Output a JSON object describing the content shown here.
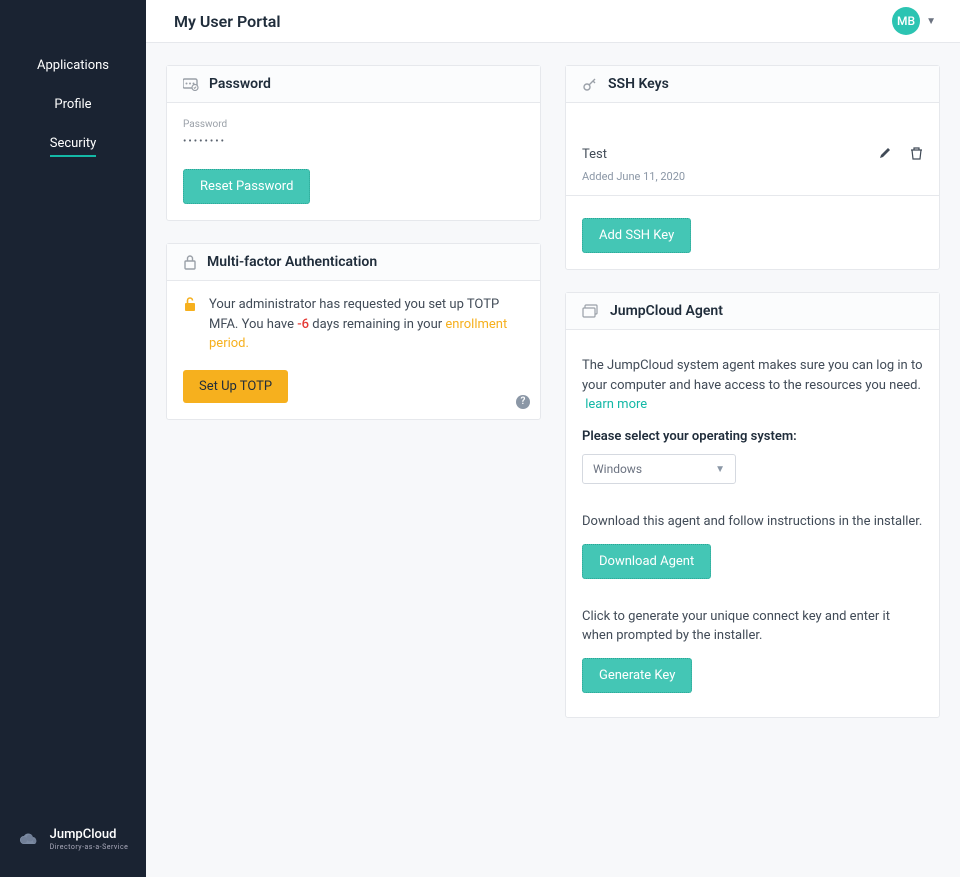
{
  "header": {
    "title": "My User Portal",
    "avatar_initials": "MB"
  },
  "sidebar": {
    "items": [
      {
        "label": "Applications"
      },
      {
        "label": "Profile"
      },
      {
        "label": "Security"
      }
    ],
    "brand": {
      "name": "JumpCloud",
      "tagline": "Directory-as-a-Service"
    }
  },
  "password": {
    "card_title": "Password",
    "field_label": "Password",
    "masked_value": "••••••••",
    "reset_btn": "Reset Password"
  },
  "mfa": {
    "card_title": "Multi-factor Authentication",
    "alert_prefix": "Your administrator has requested you set up TOTP MFA. You have ",
    "days_remaining": "-6",
    "alert_mid": " days remaining in your ",
    "link_text": "enrollment period.",
    "setup_btn": "Set Up TOTP"
  },
  "ssh": {
    "card_title": "SSH Keys",
    "keys": [
      {
        "name": "Test",
        "added": "Added June 11, 2020"
      }
    ],
    "add_btn": "Add SSH Key"
  },
  "agent": {
    "card_title": "JumpCloud Agent",
    "description": "The JumpCloud system agent makes sure you can log in to your computer and have access to the resources you need.",
    "learn_more": "learn more",
    "os_label": "Please select your operating system:",
    "os_selected": "Windows",
    "download_text": "Download this agent and follow instructions in the installer.",
    "download_btn": "Download Agent",
    "key_text": "Click to generate your unique connect key and enter it when prompted by the installer.",
    "key_btn": "Generate Key"
  }
}
